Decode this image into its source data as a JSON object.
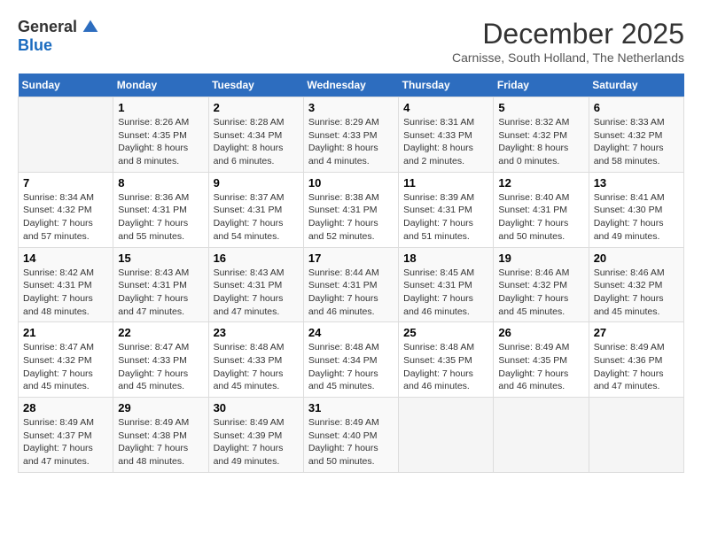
{
  "logo": {
    "general": "General",
    "blue": "Blue"
  },
  "title": "December 2025",
  "subtitle": "Carnisse, South Holland, The Netherlands",
  "days_header": [
    "Sunday",
    "Monday",
    "Tuesday",
    "Wednesday",
    "Thursday",
    "Friday",
    "Saturday"
  ],
  "weeks": [
    [
      {
        "day": "",
        "info": ""
      },
      {
        "day": "1",
        "info": "Sunrise: 8:26 AM\nSunset: 4:35 PM\nDaylight: 8 hours\nand 8 minutes."
      },
      {
        "day": "2",
        "info": "Sunrise: 8:28 AM\nSunset: 4:34 PM\nDaylight: 8 hours\nand 6 minutes."
      },
      {
        "day": "3",
        "info": "Sunrise: 8:29 AM\nSunset: 4:33 PM\nDaylight: 8 hours\nand 4 minutes."
      },
      {
        "day": "4",
        "info": "Sunrise: 8:31 AM\nSunset: 4:33 PM\nDaylight: 8 hours\nand 2 minutes."
      },
      {
        "day": "5",
        "info": "Sunrise: 8:32 AM\nSunset: 4:32 PM\nDaylight: 8 hours\nand 0 minutes."
      },
      {
        "day": "6",
        "info": "Sunrise: 8:33 AM\nSunset: 4:32 PM\nDaylight: 7 hours\nand 58 minutes."
      }
    ],
    [
      {
        "day": "7",
        "info": "Sunrise: 8:34 AM\nSunset: 4:32 PM\nDaylight: 7 hours\nand 57 minutes."
      },
      {
        "day": "8",
        "info": "Sunrise: 8:36 AM\nSunset: 4:31 PM\nDaylight: 7 hours\nand 55 minutes."
      },
      {
        "day": "9",
        "info": "Sunrise: 8:37 AM\nSunset: 4:31 PM\nDaylight: 7 hours\nand 54 minutes."
      },
      {
        "day": "10",
        "info": "Sunrise: 8:38 AM\nSunset: 4:31 PM\nDaylight: 7 hours\nand 52 minutes."
      },
      {
        "day": "11",
        "info": "Sunrise: 8:39 AM\nSunset: 4:31 PM\nDaylight: 7 hours\nand 51 minutes."
      },
      {
        "day": "12",
        "info": "Sunrise: 8:40 AM\nSunset: 4:31 PM\nDaylight: 7 hours\nand 50 minutes."
      },
      {
        "day": "13",
        "info": "Sunrise: 8:41 AM\nSunset: 4:30 PM\nDaylight: 7 hours\nand 49 minutes."
      }
    ],
    [
      {
        "day": "14",
        "info": "Sunrise: 8:42 AM\nSunset: 4:31 PM\nDaylight: 7 hours\nand 48 minutes."
      },
      {
        "day": "15",
        "info": "Sunrise: 8:43 AM\nSunset: 4:31 PM\nDaylight: 7 hours\nand 47 minutes."
      },
      {
        "day": "16",
        "info": "Sunrise: 8:43 AM\nSunset: 4:31 PM\nDaylight: 7 hours\nand 47 minutes."
      },
      {
        "day": "17",
        "info": "Sunrise: 8:44 AM\nSunset: 4:31 PM\nDaylight: 7 hours\nand 46 minutes."
      },
      {
        "day": "18",
        "info": "Sunrise: 8:45 AM\nSunset: 4:31 PM\nDaylight: 7 hours\nand 46 minutes."
      },
      {
        "day": "19",
        "info": "Sunrise: 8:46 AM\nSunset: 4:32 PM\nDaylight: 7 hours\nand 45 minutes."
      },
      {
        "day": "20",
        "info": "Sunrise: 8:46 AM\nSunset: 4:32 PM\nDaylight: 7 hours\nand 45 minutes."
      }
    ],
    [
      {
        "day": "21",
        "info": "Sunrise: 8:47 AM\nSunset: 4:32 PM\nDaylight: 7 hours\nand 45 minutes."
      },
      {
        "day": "22",
        "info": "Sunrise: 8:47 AM\nSunset: 4:33 PM\nDaylight: 7 hours\nand 45 minutes."
      },
      {
        "day": "23",
        "info": "Sunrise: 8:48 AM\nSunset: 4:33 PM\nDaylight: 7 hours\nand 45 minutes."
      },
      {
        "day": "24",
        "info": "Sunrise: 8:48 AM\nSunset: 4:34 PM\nDaylight: 7 hours\nand 45 minutes."
      },
      {
        "day": "25",
        "info": "Sunrise: 8:48 AM\nSunset: 4:35 PM\nDaylight: 7 hours\nand 46 minutes."
      },
      {
        "day": "26",
        "info": "Sunrise: 8:49 AM\nSunset: 4:35 PM\nDaylight: 7 hours\nand 46 minutes."
      },
      {
        "day": "27",
        "info": "Sunrise: 8:49 AM\nSunset: 4:36 PM\nDaylight: 7 hours\nand 47 minutes."
      }
    ],
    [
      {
        "day": "28",
        "info": "Sunrise: 8:49 AM\nSunset: 4:37 PM\nDaylight: 7 hours\nand 47 minutes."
      },
      {
        "day": "29",
        "info": "Sunrise: 8:49 AM\nSunset: 4:38 PM\nDaylight: 7 hours\nand 48 minutes."
      },
      {
        "day": "30",
        "info": "Sunrise: 8:49 AM\nSunset: 4:39 PM\nDaylight: 7 hours\nand 49 minutes."
      },
      {
        "day": "31",
        "info": "Sunrise: 8:49 AM\nSunset: 4:40 PM\nDaylight: 7 hours\nand 50 minutes."
      },
      {
        "day": "",
        "info": ""
      },
      {
        "day": "",
        "info": ""
      },
      {
        "day": "",
        "info": ""
      }
    ]
  ]
}
